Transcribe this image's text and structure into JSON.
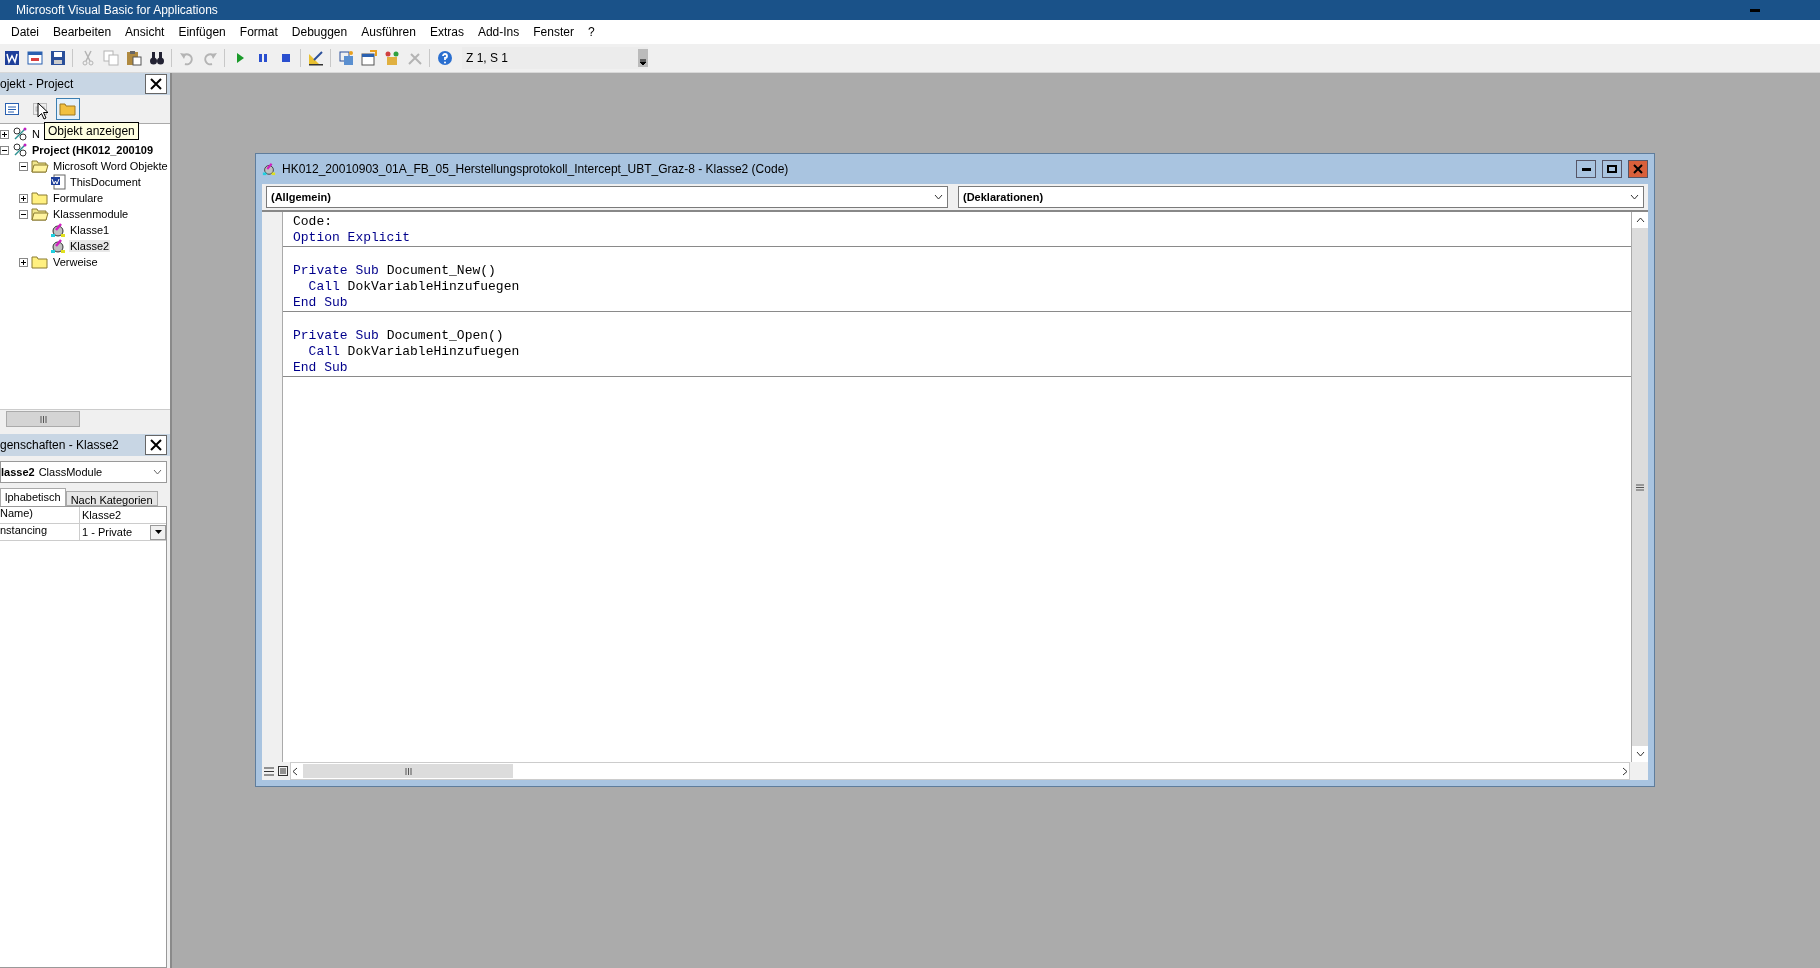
{
  "window": {
    "title": "Microsoft Visual Basic for Applications"
  },
  "menu": [
    "Datei",
    "Bearbeiten",
    "Ansicht",
    "Einfügen",
    "Format",
    "Debuggen",
    "Ausführen",
    "Extras",
    "Add-Ins",
    "Fenster",
    "?"
  ],
  "toolbar": {
    "buttons": [
      {
        "kind": "word",
        "disabled": false
      },
      {
        "kind": "userform",
        "disabled": false
      },
      {
        "kind": "save",
        "disabled": false
      },
      {
        "kind": "cut",
        "disabled": true
      },
      {
        "kind": "copy",
        "disabled": true
      },
      {
        "kind": "paste",
        "disabled": false
      },
      {
        "kind": "find",
        "disabled": false
      },
      {
        "kind": "undo",
        "disabled": true
      },
      {
        "kind": "redo",
        "disabled": true
      },
      {
        "kind": "run",
        "disabled": false
      },
      {
        "kind": "pause",
        "disabled": false
      },
      {
        "kind": "stop",
        "disabled": false
      },
      {
        "kind": "design",
        "disabled": false
      },
      {
        "kind": "project",
        "disabled": false
      },
      {
        "kind": "properties",
        "disabled": false
      },
      {
        "kind": "objects",
        "disabled": false
      },
      {
        "kind": "toolbox",
        "disabled": true
      },
      {
        "kind": "help",
        "disabled": false
      }
    ],
    "position": "Z 1, S 1"
  },
  "project_panel": {
    "title": "ojekt - Project",
    "tools": [
      {
        "kind": "code",
        "selected": false
      },
      {
        "kind": "object",
        "selected": false
      },
      {
        "kind": "folders",
        "selected": true
      }
    ],
    "tooltip": "Objekt anzeigen",
    "tree": [
      {
        "label": "N",
        "kind": "project",
        "bold": false,
        "expanded": false,
        "selected": false
      },
      {
        "label": "Project (HK012_200109",
        "kind": "project",
        "bold": true,
        "expanded": true,
        "selected": false,
        "children": [
          {
            "label": "Microsoft Word Objekte",
            "kind": "folder",
            "bold": false,
            "expanded": true,
            "selected": false,
            "children": [
              {
                "label": "ThisDocument",
                "kind": "document",
                "bold": false,
                "selected": false
              }
            ]
          },
          {
            "label": "Formulare",
            "kind": "folder",
            "bold": false,
            "expanded": false,
            "selected": false
          },
          {
            "label": "Klassenmodule",
            "kind": "folder",
            "bold": false,
            "expanded": true,
            "selected": false,
            "children": [
              {
                "label": "Klasse1",
                "kind": "class",
                "bold": false,
                "selected": false
              },
              {
                "label": "Klasse2",
                "kind": "class",
                "bold": false,
                "selected": true
              }
            ]
          },
          {
            "label": "Verweise",
            "kind": "folder",
            "bold": false,
            "expanded": false,
            "selected": false
          }
        ]
      }
    ]
  },
  "properties_panel": {
    "title": "genschaften - Klasse2",
    "object": {
      "name": "lasse2",
      "type": "ClassModule"
    },
    "tabs": [
      {
        "label": "lphabetisch",
        "selected": true
      },
      {
        "label": "Nach Kategorien",
        "selected": false
      }
    ],
    "rows": [
      {
        "name": "Name)",
        "value": "Klasse2",
        "kind": "text"
      },
      {
        "name": "nstancing",
        "value": "1 - Private",
        "kind": "dropdown"
      }
    ]
  },
  "code_window": {
    "title": "HK012_20010903_01A_FB_05_Herstellungsprotokoll_Intercept_UBT_Graz-8 - Klasse2 (Code)",
    "object_combo": "(Allgemein)",
    "procedure_combo": "(Deklarationen)",
    "sections": [
      {
        "lines": [
          {
            "kind": "code",
            "tokens": [
              {
                "text": "Code:",
                "kind": "plain"
              }
            ]
          },
          {
            "kind": "code",
            "tokens": [
              {
                "text": "Option Explicit",
                "kind": "keyword"
              }
            ]
          }
        ]
      },
      {
        "lines": [
          {
            "kind": "blank"
          },
          {
            "kind": "code",
            "tokens": [
              {
                "text": "Private Sub",
                "kind": "keyword"
              },
              {
                "text": " Document_New()",
                "kind": "plain"
              }
            ]
          },
          {
            "kind": "code",
            "tokens": [
              {
                "text": "  Call",
                "kind": "keyword"
              },
              {
                "text": " DokVariableHinzufuegen",
                "kind": "plain"
              }
            ]
          },
          {
            "kind": "code",
            "tokens": [
              {
                "text": "End Sub",
                "kind": "keyword"
              }
            ]
          }
        ]
      },
      {
        "lines": [
          {
            "kind": "blank"
          },
          {
            "kind": "code",
            "tokens": [
              {
                "text": "Private Sub",
                "kind": "keyword"
              },
              {
                "text": " Document_Open()",
                "kind": "plain"
              }
            ]
          },
          {
            "kind": "code",
            "tokens": [
              {
                "text": "  Call",
                "kind": "keyword"
              },
              {
                "text": " DokVariableHinzufuegen",
                "kind": "plain"
              }
            ]
          },
          {
            "kind": "code",
            "tokens": [
              {
                "text": "End Sub",
                "kind": "keyword"
              }
            ]
          }
        ]
      }
    ]
  }
}
